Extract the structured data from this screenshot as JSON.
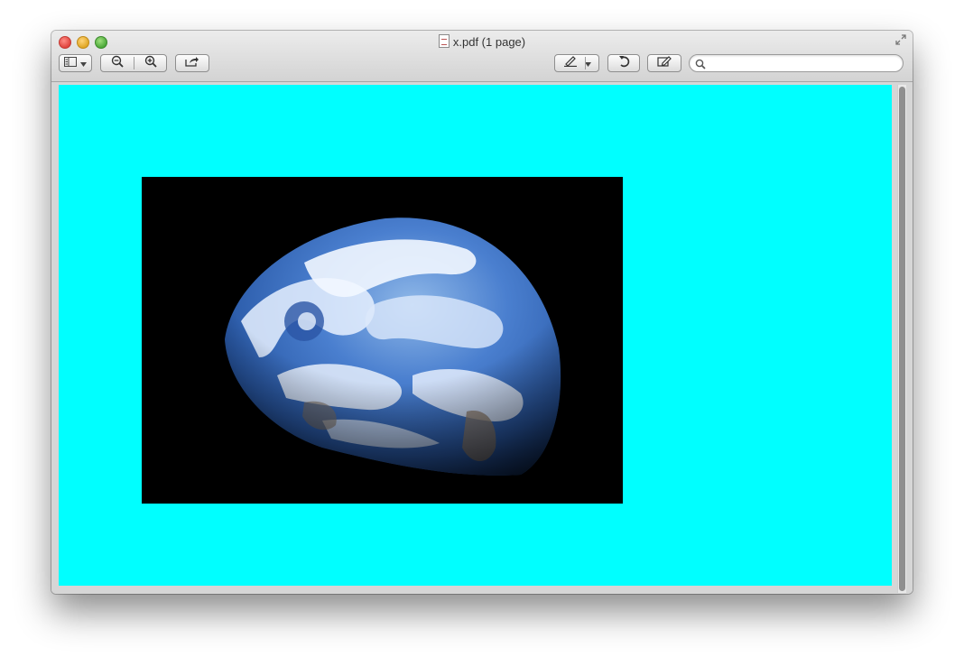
{
  "window": {
    "title": "x.pdf (1 page)"
  },
  "toolbar": {
    "sidebar_icon": "sidebar-icon",
    "zoom_out_icon": "zoom-out-icon",
    "zoom_in_icon": "zoom-in-icon",
    "share_icon": "share-icon",
    "markup_icon": "highlight-pen-icon",
    "rotate_icon": "rotate-icon",
    "edit_icon": "edit-pencil-icon"
  },
  "search": {
    "value": "",
    "placeholder": ""
  },
  "document": {
    "page_color": "#00ffff",
    "image_subject": "earth-photo"
  }
}
